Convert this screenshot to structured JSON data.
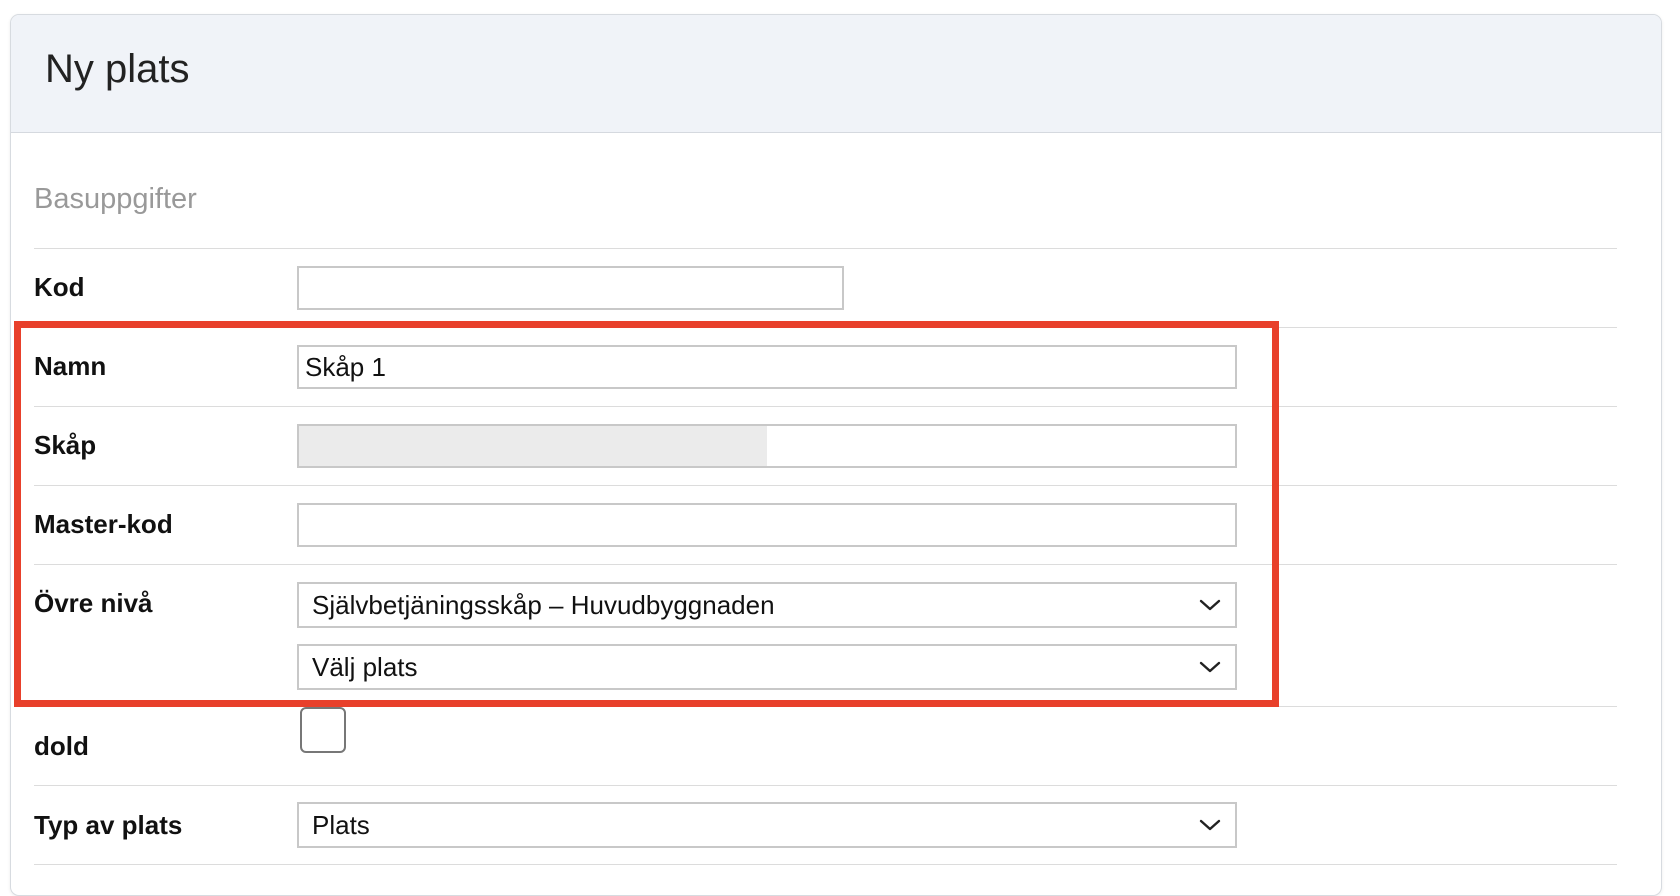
{
  "header": {
    "title": "Ny plats"
  },
  "section": {
    "title": "Basuppgifter"
  },
  "fields": {
    "kod": {
      "label": "Kod",
      "value": ""
    },
    "namn": {
      "label": "Namn",
      "value": "Skåp 1"
    },
    "skap": {
      "label": "Skåp",
      "progress_fraction": 0.5
    },
    "master_kod": {
      "label": "Master-kod",
      "value": ""
    },
    "ovre_niva": {
      "label": "Övre nivå",
      "select1": "Självbetjäningsskåp – Huvudbyggnaden",
      "select2": "Välj plats"
    },
    "dold": {
      "label": "dold",
      "checked": false
    },
    "typ_av_plats": {
      "label": "Typ av plats",
      "value": "Plats"
    }
  },
  "icons": {
    "dropdown": "chevron-down-icon"
  },
  "colors": {
    "highlight": "#e8402b",
    "header_bg": "#f0f3f8",
    "section_title": "#999999"
  }
}
